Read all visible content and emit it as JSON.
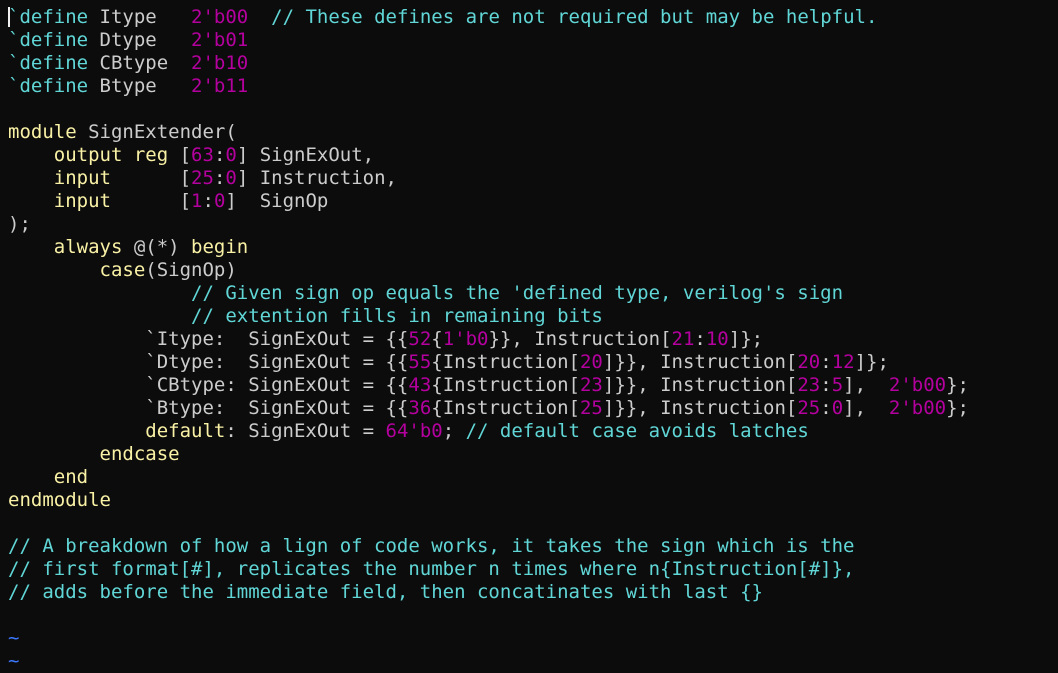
{
  "colors": {
    "background": "#0c0c0c",
    "plain": "#cccccc",
    "preproc": "#61d6d6",
    "keyword": "#f9f1a5",
    "number": "#b4009e",
    "comment": "#61d6d6",
    "tilde": "#3b78ff"
  },
  "editor": {
    "lines": [
      [
        {
          "t": "`define",
          "c": "preproc"
        },
        {
          "t": " Itype   ",
          "c": "plain"
        },
        {
          "t": "2'b00",
          "c": "number"
        },
        {
          "t": "  ",
          "c": "plain"
        },
        {
          "t": "// These defines are not required but may be helpful.",
          "c": "comment"
        }
      ],
      [
        {
          "t": "`define",
          "c": "preproc"
        },
        {
          "t": " Dtype   ",
          "c": "plain"
        },
        {
          "t": "2'b01",
          "c": "number"
        }
      ],
      [
        {
          "t": "`define",
          "c": "preproc"
        },
        {
          "t": " CBtype  ",
          "c": "plain"
        },
        {
          "t": "2'b10",
          "c": "number"
        }
      ],
      [
        {
          "t": "`define",
          "c": "preproc"
        },
        {
          "t": " Btype   ",
          "c": "plain"
        },
        {
          "t": "2'b11",
          "c": "number"
        }
      ],
      [],
      [
        {
          "t": "module",
          "c": "keyword"
        },
        {
          "t": " SignExtender(",
          "c": "plain"
        }
      ],
      [
        {
          "t": "    ",
          "c": "plain"
        },
        {
          "t": "output reg",
          "c": "keyword"
        },
        {
          "t": " [",
          "c": "plain"
        },
        {
          "t": "63",
          "c": "number"
        },
        {
          "t": ":",
          "c": "plain"
        },
        {
          "t": "0",
          "c": "number"
        },
        {
          "t": "] SignExOut,",
          "c": "plain"
        }
      ],
      [
        {
          "t": "    ",
          "c": "plain"
        },
        {
          "t": "input",
          "c": "keyword"
        },
        {
          "t": "      [",
          "c": "plain"
        },
        {
          "t": "25",
          "c": "number"
        },
        {
          "t": ":",
          "c": "plain"
        },
        {
          "t": "0",
          "c": "number"
        },
        {
          "t": "] Instruction,",
          "c": "plain"
        }
      ],
      [
        {
          "t": "    ",
          "c": "plain"
        },
        {
          "t": "input",
          "c": "keyword"
        },
        {
          "t": "      [",
          "c": "plain"
        },
        {
          "t": "1",
          "c": "number"
        },
        {
          "t": ":",
          "c": "plain"
        },
        {
          "t": "0",
          "c": "number"
        },
        {
          "t": "]  SignOp",
          "c": "plain"
        }
      ],
      [
        {
          "t": ");",
          "c": "plain"
        }
      ],
      [
        {
          "t": "    ",
          "c": "plain"
        },
        {
          "t": "always",
          "c": "keyword"
        },
        {
          "t": " @(*) ",
          "c": "plain"
        },
        {
          "t": "begin",
          "c": "keyword"
        }
      ],
      [
        {
          "t": "        ",
          "c": "plain"
        },
        {
          "t": "case",
          "c": "keyword"
        },
        {
          "t": "(SignOp)",
          "c": "plain"
        }
      ],
      [
        {
          "t": "                ",
          "c": "plain"
        },
        {
          "t": "// Given sign op equals the 'defined type, verilog's sign",
          "c": "comment"
        }
      ],
      [
        {
          "t": "                ",
          "c": "plain"
        },
        {
          "t": "// extention fills in remaining bits",
          "c": "comment"
        }
      ],
      [
        {
          "t": "            `Itype:  SignExOut = {{",
          "c": "plain"
        },
        {
          "t": "52",
          "c": "number"
        },
        {
          "t": "{",
          "c": "plain"
        },
        {
          "t": "1'b0",
          "c": "number"
        },
        {
          "t": "}}, Instruction[",
          "c": "plain"
        },
        {
          "t": "21",
          "c": "number"
        },
        {
          "t": ":",
          "c": "plain"
        },
        {
          "t": "10",
          "c": "number"
        },
        {
          "t": "]};",
          "c": "plain"
        }
      ],
      [
        {
          "t": "            `Dtype:  SignExOut = {{",
          "c": "plain"
        },
        {
          "t": "55",
          "c": "number"
        },
        {
          "t": "{Instruction[",
          "c": "plain"
        },
        {
          "t": "20",
          "c": "number"
        },
        {
          "t": "]}}, Instruction[",
          "c": "plain"
        },
        {
          "t": "20",
          "c": "number"
        },
        {
          "t": ":",
          "c": "plain"
        },
        {
          "t": "12",
          "c": "number"
        },
        {
          "t": "]};",
          "c": "plain"
        }
      ],
      [
        {
          "t": "            `CBtype: SignExOut = {{",
          "c": "plain"
        },
        {
          "t": "43",
          "c": "number"
        },
        {
          "t": "{Instruction[",
          "c": "plain"
        },
        {
          "t": "23",
          "c": "number"
        },
        {
          "t": "]}}, Instruction[",
          "c": "plain"
        },
        {
          "t": "23",
          "c": "number"
        },
        {
          "t": ":",
          "c": "plain"
        },
        {
          "t": "5",
          "c": "number"
        },
        {
          "t": "],  ",
          "c": "plain"
        },
        {
          "t": "2'b00",
          "c": "number"
        },
        {
          "t": "};",
          "c": "plain"
        }
      ],
      [
        {
          "t": "            `Btype:  SignExOut = {{",
          "c": "plain"
        },
        {
          "t": "36",
          "c": "number"
        },
        {
          "t": "{Instruction[",
          "c": "plain"
        },
        {
          "t": "25",
          "c": "number"
        },
        {
          "t": "]}}, Instruction[",
          "c": "plain"
        },
        {
          "t": "25",
          "c": "number"
        },
        {
          "t": ":",
          "c": "plain"
        },
        {
          "t": "0",
          "c": "number"
        },
        {
          "t": "],  ",
          "c": "plain"
        },
        {
          "t": "2'b00",
          "c": "number"
        },
        {
          "t": "};",
          "c": "plain"
        }
      ],
      [
        {
          "t": "            ",
          "c": "plain"
        },
        {
          "t": "default",
          "c": "keyword"
        },
        {
          "t": ": SignExOut = ",
          "c": "plain"
        },
        {
          "t": "64'b0",
          "c": "number"
        },
        {
          "t": "; ",
          "c": "plain"
        },
        {
          "t": "// default case avoids latches",
          "c": "comment"
        }
      ],
      [
        {
          "t": "        ",
          "c": "plain"
        },
        {
          "t": "endcase",
          "c": "keyword"
        }
      ],
      [
        {
          "t": "    ",
          "c": "plain"
        },
        {
          "t": "end",
          "c": "keyword"
        }
      ],
      [
        {
          "t": "endmodule",
          "c": "keyword"
        }
      ],
      [],
      [
        {
          "t": "// A breakdown of how a lign of code works, it takes the sign which is the",
          "c": "comment"
        }
      ],
      [
        {
          "t": "// first format[#], replicates the number n times where n{Instruction[#]},",
          "c": "comment"
        }
      ],
      [
        {
          "t": "// adds before the immediate field, then concatinates with last {}",
          "c": "comment"
        }
      ],
      [],
      [
        {
          "t": "~",
          "c": "tilde"
        }
      ],
      [
        {
          "t": "~",
          "c": "tilde"
        }
      ]
    ]
  }
}
